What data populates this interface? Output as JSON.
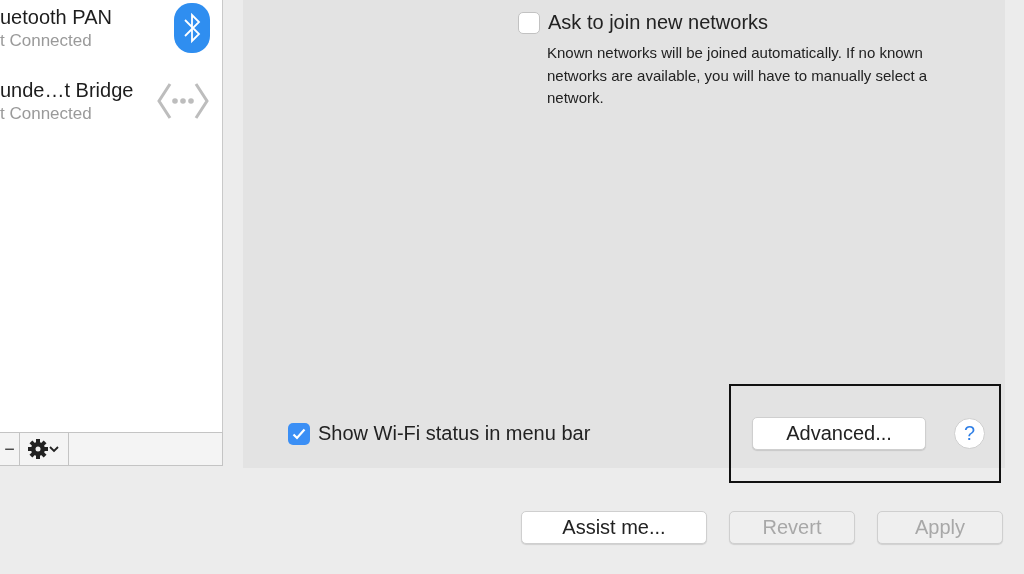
{
  "sidebar": {
    "items": [
      {
        "name": "uetooth PAN",
        "status": "t Connected",
        "kind": "bluetooth"
      },
      {
        "name": "unde…t Bridge",
        "status": "t Connected",
        "kind": "bridge"
      }
    ],
    "toolbar": {
      "remove": "−"
    }
  },
  "panel": {
    "ask_to_join": {
      "label": "Ask to join new networks",
      "checked": false,
      "description": "Known networks will be joined automatically. If no known networks are available, you will have to manually select a network."
    },
    "show_status": {
      "label": "Show Wi-Fi status in menu bar",
      "checked": true
    },
    "advanced_button": "Advanced...",
    "help": "?"
  },
  "buttons": [
    {
      "label": "Assist me...",
      "disabled": false
    },
    {
      "label": "Revert",
      "disabled": true
    },
    {
      "label": "Apply",
      "disabled": true
    }
  ]
}
